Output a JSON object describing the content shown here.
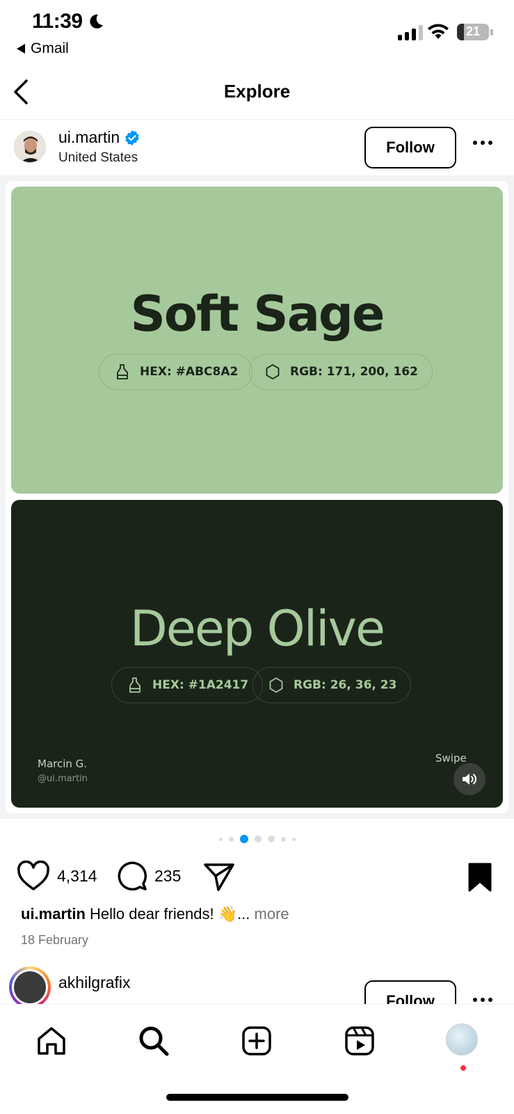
{
  "status_bar": {
    "time": "11:39",
    "back_app": "Gmail",
    "battery": "21",
    "battery_level": 0.21
  },
  "header": {
    "title": "Explore"
  },
  "post": {
    "username": "ui.martin",
    "location": "United States",
    "follow_label": "Follow",
    "slides": [
      {
        "title": "Soft Sage",
        "hex_label": "HEX: #ABC8A2",
        "rgb_label": "RGB: 171, 200, 162",
        "background": "#A6C99C",
        "text_color": "#1B2419"
      },
      {
        "title": "Deep Olive",
        "hex_label": "HEX: #1A2417",
        "rgb_label": "RGB: 26, 36, 23",
        "background": "#1B2419",
        "text_color": "#A6C99C",
        "author_name": "Marcin G.",
        "author_handle": "@ui.martin",
        "swipe_label": "Swipe"
      }
    ],
    "carousel": {
      "total": 7,
      "active_index": 2
    },
    "likes": "4,314",
    "comments": "235",
    "caption_user": "ui.martin",
    "caption_text": "Hello dear friends! 👋...",
    "caption_more": "more",
    "date": "18 February"
  },
  "next_post": {
    "username": "akhilgrafix",
    "follow_label": "Follow"
  },
  "tab_bar": {
    "items": [
      "home-icon",
      "search-icon",
      "create-icon",
      "reels-icon",
      "profile-avatar"
    ]
  },
  "colors": {
    "accent": "#0095F6",
    "verified": "#0095F6",
    "notification": "#FF3040"
  }
}
